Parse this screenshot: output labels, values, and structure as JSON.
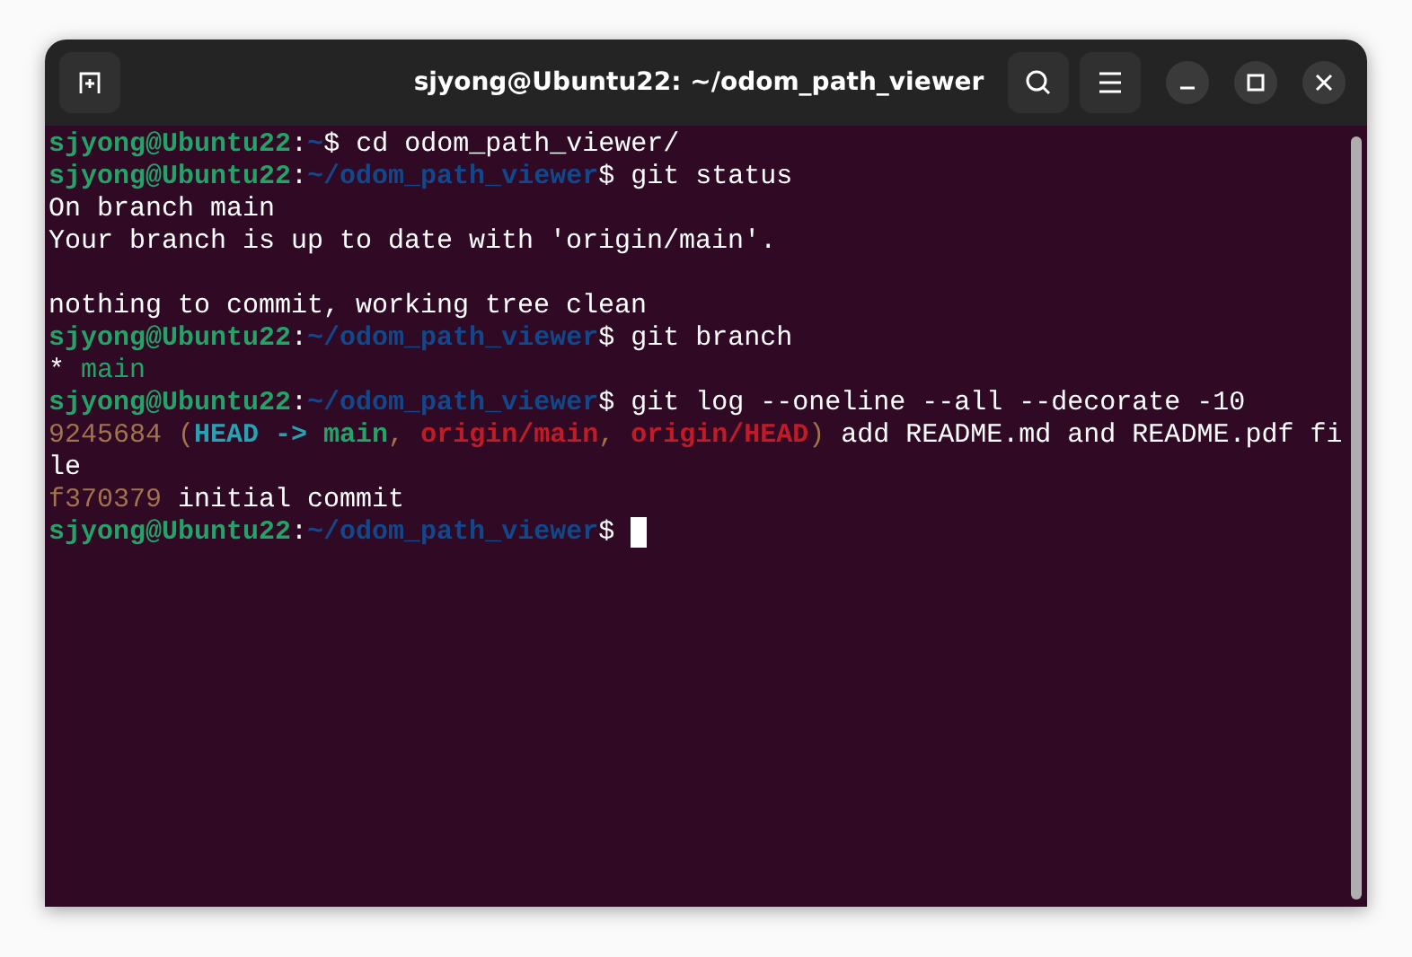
{
  "window": {
    "title": "sjyong@Ubuntu22: ~/odom_path_viewer"
  },
  "terminal": {
    "lines": [
      [
        {
          "kind": "user",
          "text": "sjyong@Ubuntu22"
        },
        {
          "kind": "plain",
          "text": ":"
        },
        {
          "kind": "path",
          "text": "~"
        },
        {
          "kind": "plain",
          "text": "$ cd odom_path_viewer/"
        }
      ],
      [
        {
          "kind": "user",
          "text": "sjyong@Ubuntu22"
        },
        {
          "kind": "plain",
          "text": ":"
        },
        {
          "kind": "path",
          "text": "~/odom_path_viewer"
        },
        {
          "kind": "plain",
          "text": "$ git status"
        }
      ],
      [
        {
          "kind": "plain",
          "text": "On branch main"
        }
      ],
      [
        {
          "kind": "plain",
          "text": "Your branch is up to date with 'origin/main'."
        }
      ],
      [
        {
          "kind": "blank"
        }
      ],
      [
        {
          "kind": "plain",
          "text": "nothing to commit, working tree clean"
        }
      ],
      [
        {
          "kind": "user",
          "text": "sjyong@Ubuntu22"
        },
        {
          "kind": "plain",
          "text": ":"
        },
        {
          "kind": "path",
          "text": "~/odom_path_viewer"
        },
        {
          "kind": "plain",
          "text": "$ git branch"
        }
      ],
      [
        {
          "kind": "plain",
          "text": "* "
        },
        {
          "kind": "branch",
          "text": "main"
        }
      ],
      [
        {
          "kind": "user",
          "text": "sjyong@Ubuntu22"
        },
        {
          "kind": "plain",
          "text": ":"
        },
        {
          "kind": "path",
          "text": "~/odom_path_viewer"
        },
        {
          "kind": "plain",
          "text": "$ git log --oneline --all --decorate -10"
        }
      ],
      [
        {
          "kind": "hash",
          "text": "9245684 ("
        },
        {
          "kind": "head",
          "text": "HEAD -> "
        },
        {
          "kind": "local",
          "text": "main"
        },
        {
          "kind": "hash",
          "text": ", "
        },
        {
          "kind": "remote",
          "text": "origin/main"
        },
        {
          "kind": "hash",
          "text": ", "
        },
        {
          "kind": "remote",
          "text": "origin/HEAD"
        },
        {
          "kind": "hash",
          "text": ")"
        },
        {
          "kind": "plain",
          "text": " add README.md and README.pdf fi"
        }
      ],
      [
        {
          "kind": "plain",
          "text": "le"
        }
      ],
      [
        {
          "kind": "hash",
          "text": "f370379"
        },
        {
          "kind": "plain",
          "text": " initial commit"
        }
      ],
      [
        {
          "kind": "user",
          "text": "sjyong@Ubuntu22"
        },
        {
          "kind": "plain",
          "text": ":"
        },
        {
          "kind": "path",
          "text": "~/odom_path_viewer"
        },
        {
          "kind": "plain",
          "text": "$ "
        },
        {
          "kind": "cursor"
        }
      ]
    ]
  }
}
